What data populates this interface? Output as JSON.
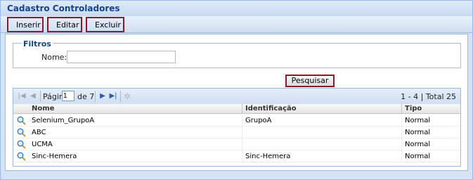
{
  "window": {
    "title": "Cadastro Controladores"
  },
  "toolbar": {
    "insert_label": "Inserir",
    "edit_label": "Editar",
    "delete_label": "Excluir"
  },
  "filters": {
    "legend": "Filtros",
    "name_label": "Nome:",
    "name_value": "",
    "search_label": "Pesquisar"
  },
  "pager": {
    "page_label": "Página",
    "page_value": "1",
    "of_label": "de 7",
    "total": "1 - 4 | Total 25"
  },
  "grid": {
    "columns": [
      "Nome",
      "Identificação",
      "Tipo"
    ],
    "rows": [
      {
        "nome": "Selenium_GrupoA",
        "identificacao": "GrupoA",
        "tipo": "Normal"
      },
      {
        "nome": "ABC",
        "identificacao": "",
        "tipo": "Normal"
      },
      {
        "nome": "UCMA",
        "identificacao": "",
        "tipo": "Normal"
      },
      {
        "nome": "Sinc-Hemera",
        "identificacao": "Sinc-Hemera",
        "tipo": "Normal"
      }
    ]
  },
  "colors": {
    "accent": "#15428b",
    "highlight_border": "#8b1a2a"
  },
  "icons": [
    "globe-icon",
    "first-page-icon",
    "prev-page-icon",
    "next-page-icon",
    "last-page-icon",
    "refresh-icon",
    "magnifier-icon"
  ]
}
